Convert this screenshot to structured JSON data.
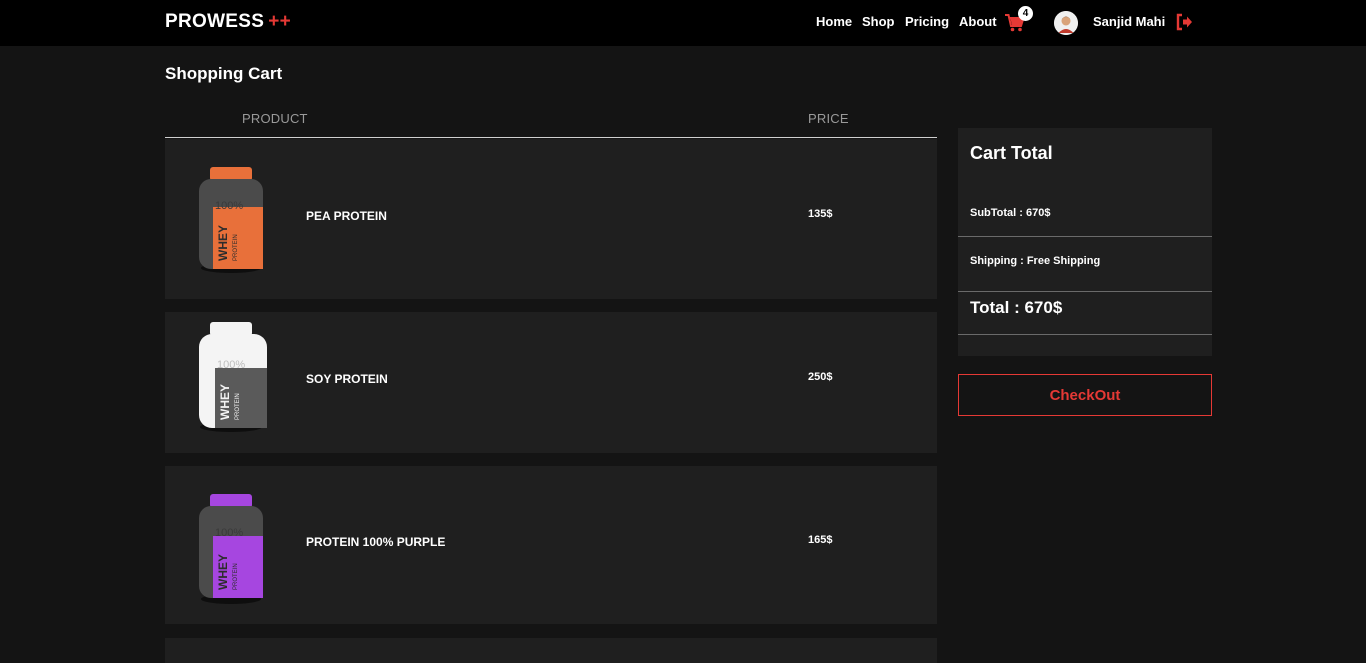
{
  "nav": {
    "brand": "PROWESS",
    "brand_suffix": "++",
    "links": [
      "Home",
      "Shop",
      "Pricing",
      "About"
    ],
    "cart_count": "4",
    "user_name": "Sanjid Mahi"
  },
  "page": {
    "title": "Shopping Cart",
    "col_product": "PRODUCT",
    "col_price": "PRICE"
  },
  "cart": {
    "items": [
      {
        "name": "PEA PROTEIN",
        "price": "135$",
        "color": "#e8703a"
      },
      {
        "name": "SOY PROTEIN",
        "price": "250$",
        "color": "#f4f4f4"
      },
      {
        "name": "PROTEIN 100% PURPLE",
        "price": "165$",
        "color": "#a646e0"
      }
    ]
  },
  "totals": {
    "title": "Cart Total",
    "subtotal": "SubTotal : 670$",
    "shipping": "Shipping : Free Shipping",
    "total": "Total : 670$",
    "checkout": "CheckOut"
  },
  "tub_text": {
    "pct": "100%",
    "whey": "WHEY",
    "protein": "PROTEIN"
  },
  "colors": {
    "accent": "#e53935",
    "panel": "#1f1f1f",
    "background": "#141414"
  },
  "icons": [
    "cart-icon",
    "user-avatar",
    "sign-out-icon"
  ]
}
